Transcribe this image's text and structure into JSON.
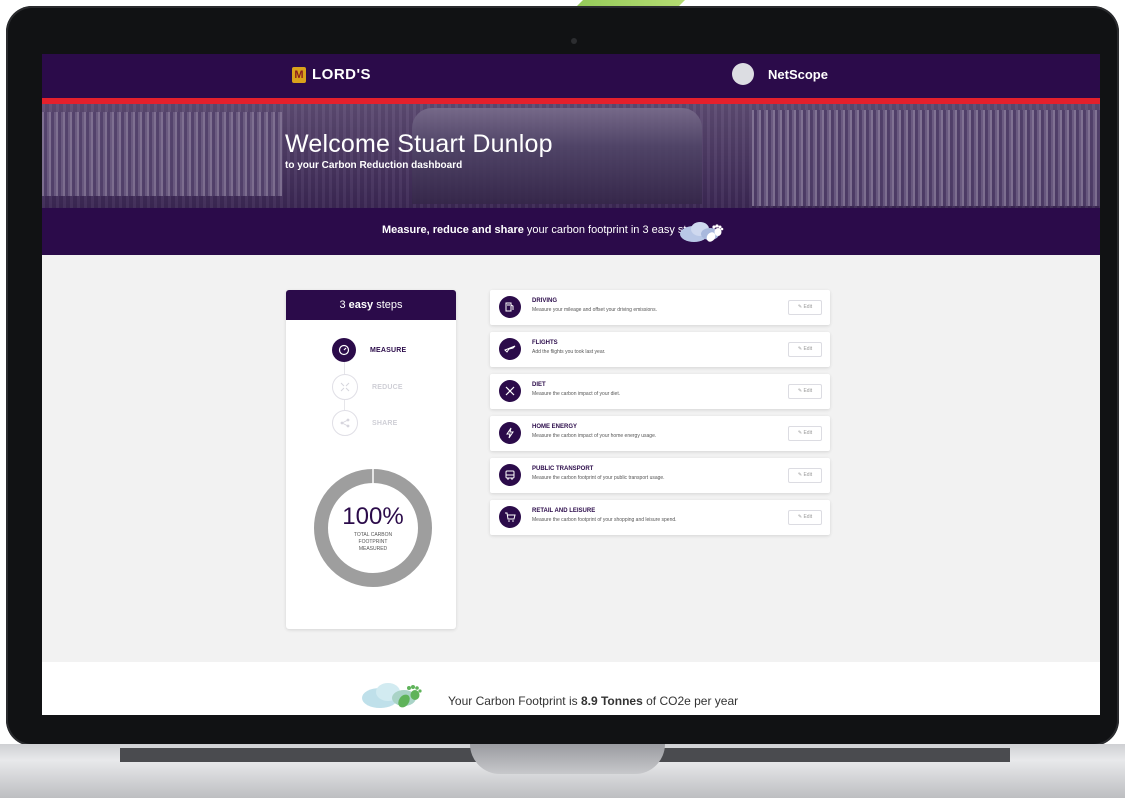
{
  "header": {
    "brand": "LORD'S",
    "brand_mark": "M",
    "user_name": "NetScope"
  },
  "banner": {
    "title": "Welcome Stuart Dunlop",
    "subtitle": "to your Carbon Reduction dashboard"
  },
  "strip": {
    "bold_text": "Measure, reduce and share",
    "rest_text": " your carbon footprint in 3 easy steps"
  },
  "steps_card": {
    "header_prefix": "3 ",
    "header_bold": "easy",
    "header_suffix": " steps",
    "steps": [
      {
        "label": "MEASURE",
        "icon": "gauge-icon",
        "active": true
      },
      {
        "label": "REDUCE",
        "icon": "arrows-in-icon",
        "active": false
      },
      {
        "label": "SHARE",
        "icon": "share-icon",
        "active": false
      }
    ],
    "progress_percent": 100,
    "progress_text": "100%",
    "progress_label_1": "TOTAL CARBON",
    "progress_label_2": "FOOTPRINT",
    "progress_label_3": "MEASURED"
  },
  "categories": [
    {
      "title": "DRIVING",
      "desc": "Measure your mileage and offset your driving emissions.",
      "icon": "fuel-pump-icon",
      "edit": "✎ Edit"
    },
    {
      "title": "FLIGHTS",
      "desc": "Add the flights you took last year.",
      "icon": "plane-icon",
      "edit": "✎ Edit"
    },
    {
      "title": "DIET",
      "desc": "Measure the carbon impact of your diet.",
      "icon": "utensils-icon",
      "edit": "✎ Edit"
    },
    {
      "title": "HOME ENERGY",
      "desc": "Measure the carbon impact of your home energy usage.",
      "icon": "lightning-icon",
      "edit": "✎ Edit"
    },
    {
      "title": "PUBLIC TRANSPORT",
      "desc": "Measure the carbon footprint of your public transport usage.",
      "icon": "bus-icon",
      "edit": "✎ Edit"
    },
    {
      "title": "RETAIL AND LEISURE",
      "desc": "Measure the carbon footprint of your shopping and leisure spend.",
      "icon": "cart-icon",
      "edit": "✎ Edit"
    }
  ],
  "footprint": {
    "prefix": "Your Carbon Footprint is ",
    "value": "8.9 Tonnes",
    "suffix": " of CO2e per year"
  },
  "colors": {
    "brand_purple": "#2b0b4a",
    "accent_red": "#e4202c",
    "donut_gray": "#9e9e9e"
  }
}
